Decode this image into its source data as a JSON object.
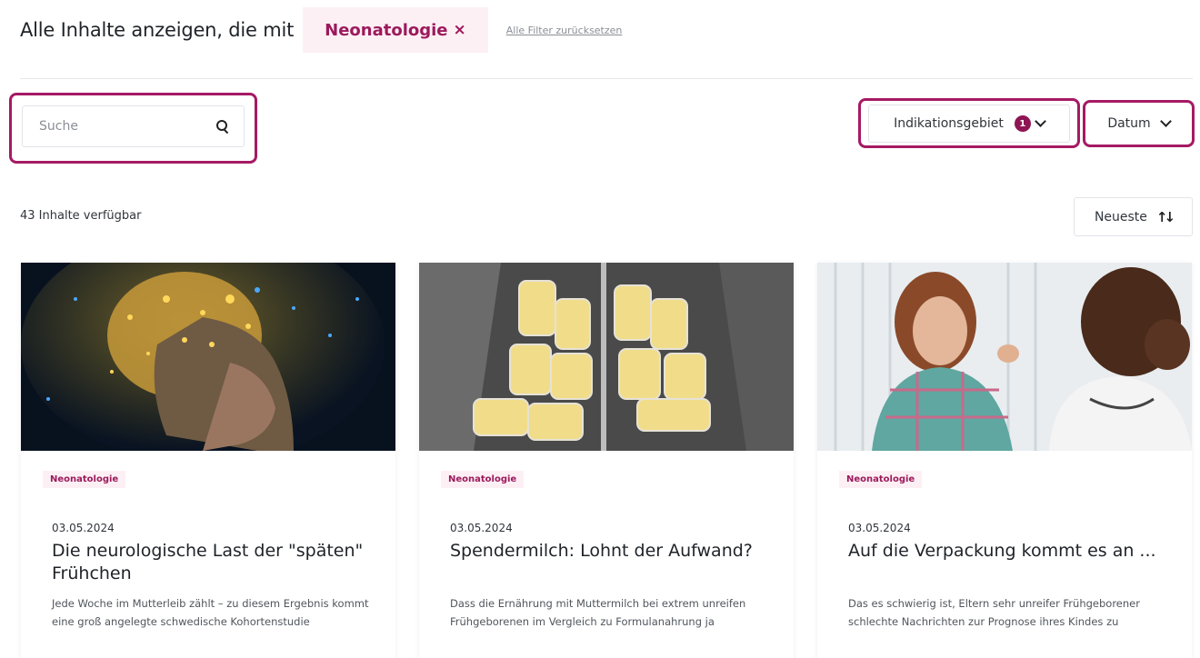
{
  "header": {
    "title": "Alle Inhalte anzeigen, die mit",
    "filter_chip": "Neonatologie",
    "filter_chip_close": "×",
    "reset_link": "Alle Filter zurücksetzen"
  },
  "search": {
    "placeholder": "Suche"
  },
  "filters": {
    "indikationsgebiet": {
      "label": "Indikationsgebiet",
      "count": "1"
    },
    "datum": {
      "label": "Datum"
    }
  },
  "results": {
    "count_text": "43 Inhalte verfügbar",
    "sort_label": "Neueste"
  },
  "colors": {
    "accent": "#9c1a5c",
    "highlight": "#a51a64",
    "chip_bg": "#fdf0f5"
  },
  "cards": [
    {
      "tag": "Neonatologie",
      "date": "03.05.2024",
      "title": "Die neurologische Last der \"späten\" Frühchen",
      "excerpt": "Jede Woche im Mutterleib zählt – zu diesem Ergebnis kommt eine groß angelegte schwedische Kohortenstudie"
    },
    {
      "tag": "Neonatologie",
      "date": "03.05.2024",
      "title": "Spendermilch: Lohnt der Aufwand?",
      "excerpt": "Dass die Ernährung mit Muttermilch bei extrem unreifen Frühgeborenen im Vergleich zu Formulanahrung ja"
    },
    {
      "tag": "Neonatologie",
      "date": "03.05.2024",
      "title": "Auf die Verpackung kommt es an ...",
      "excerpt": "Das es schwierig ist, Eltern sehr unreifer Frühgeborener schlechte Nachrichten zur Prognose ihres Kindes zu"
    }
  ]
}
